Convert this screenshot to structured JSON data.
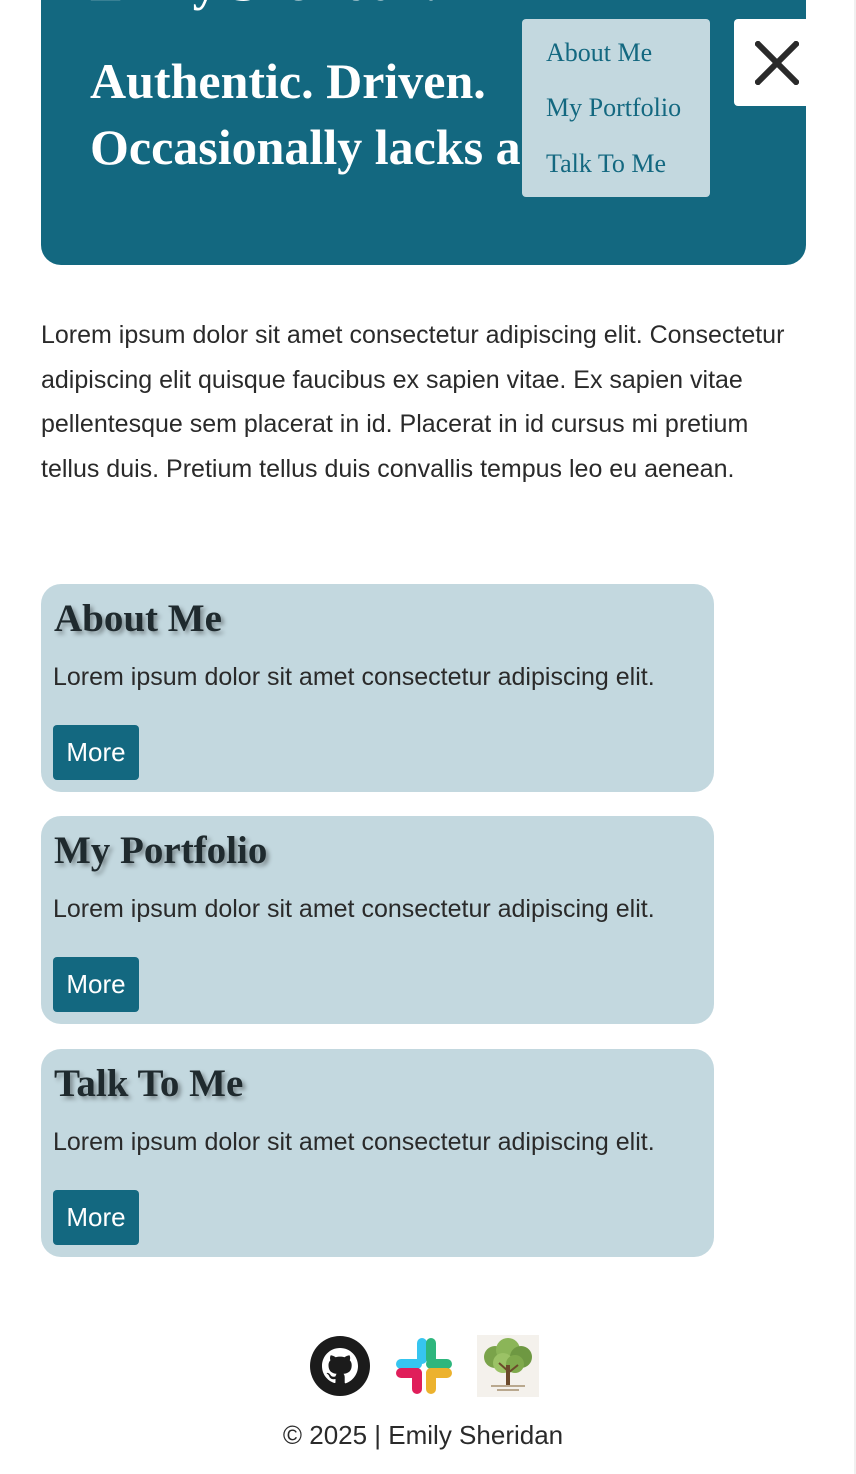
{
  "hero": {
    "line1": "Emily Sheridan.",
    "line2": "Authentic. Driven.",
    "line3": "Occasionally lacks a filter."
  },
  "menu": {
    "items": [
      "About Me",
      "My Portfolio",
      "Talk To Me"
    ]
  },
  "close_button": {
    "icon": "close-icon"
  },
  "intro": {
    "text": "Lorem ipsum dolor sit amet consectetur adipiscing elit. Consectetur adipiscing elit quisque faucibus ex sapien vitae. Ex sapien vitae pellentesque sem placerat in id. Placerat in id cursus mi pretium tellus duis. Pretium tellus duis convallis tempus leo eu aenean."
  },
  "cards": [
    {
      "title": "About Me",
      "text": "Lorem ipsum dolor sit amet consectetur adipiscing elit.",
      "button": "More"
    },
    {
      "title": "My Portfolio",
      "text": "Lorem ipsum dolor sit amet consectetur adipiscing elit.",
      "button": "More"
    },
    {
      "title": "Talk To Me",
      "text": "Lorem ipsum dolor sit amet consectetur adipiscing elit.",
      "button": "More"
    }
  ],
  "footer": {
    "icons": [
      "github-icon",
      "slack-icon",
      "tree-logo-icon"
    ],
    "copyright": "© 2025 | Emily Sheridan"
  },
  "colors": {
    "primary": "#136880",
    "card_bg": "#c3d8df",
    "text": "#2a2a2a"
  }
}
